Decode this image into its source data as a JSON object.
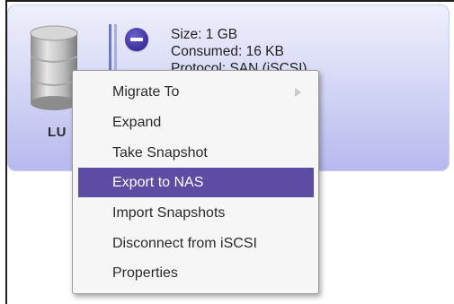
{
  "lun": {
    "label": "LU",
    "info": {
      "size": "Size: 1 GB",
      "consumed": "Consumed: 16 KB",
      "protocol": "Protocol: SAN (iSCSI)"
    }
  },
  "context_menu": {
    "items": [
      {
        "label": "Migrate To",
        "has_submenu": true
      },
      {
        "label": "Expand"
      },
      {
        "label": "Take Snapshot"
      },
      {
        "label": "Export to NAS",
        "selected": true
      },
      {
        "label": "Import Snapshots"
      },
      {
        "label": "Disconnect from iSCSI"
      },
      {
        "label": "Properties"
      }
    ]
  },
  "colors": {
    "card_gradient_top": "#eef0fb",
    "card_gradient_bottom": "#b7b8ee",
    "selection": "#5c4ca3",
    "remove_button": "#3a2f9e"
  },
  "icons": [
    "database-icon",
    "remove-icon",
    "submenu-arrow-icon"
  ]
}
